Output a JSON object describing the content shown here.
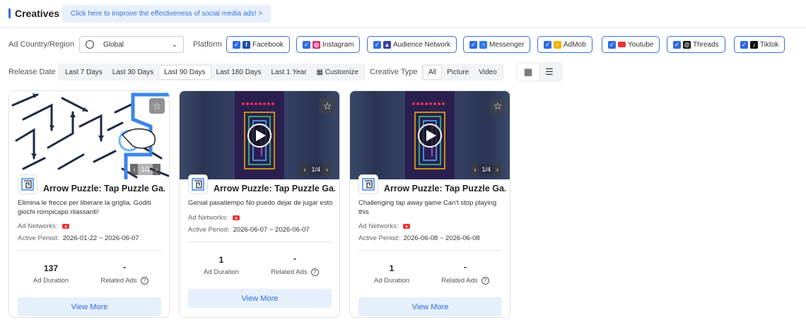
{
  "header": {
    "title": "Creatives",
    "promo": "Click here to improve the effectiveness of social media ads! >"
  },
  "filters": {
    "country_label": "Ad Country/Region",
    "country_value": "Global",
    "platform_label": "Platform",
    "platforms": [
      "Facebook",
      "Instagram",
      "Audience Network",
      "Messenger",
      "AdMob",
      "Youtube",
      "Threads",
      "Tiktok"
    ],
    "release_label": "Release Date",
    "release_options": [
      "Last 7 Days",
      "Last 30 Days",
      "Last 90 Days",
      "Last 180 Days",
      "Last 1 Year",
      "Customize"
    ],
    "release_selected": "Last 90 Days",
    "creative_label": "Creative Type",
    "creative_options": [
      "All",
      "Picture",
      "Video"
    ],
    "creative_selected": "All"
  },
  "cards": [
    {
      "title": "Arrow Puzzle: Tap Puzzle Ga...",
      "description": "Elimina le frecce per liberare la griglia. Goditi giochi rompicapo rilassanti!",
      "networks_label": "Ad Networks:",
      "period_label": "Active Period:",
      "period": "2026-01-22 ~ 2026-06-07",
      "pager": "1/2",
      "duration_value": "137",
      "duration_label": "Ad Duration",
      "related_value": "-",
      "related_label": "Related Ads",
      "button": "View More",
      "type": "picture"
    },
    {
      "title": "Arrow Puzzle: Tap Puzzle Ga...",
      "description": "Genial pasatiempo No puedo dejar de jugar esto",
      "networks_label": "Ad Networks:",
      "period_label": "Active Period:",
      "period": "2026-06-07 ~ 2026-06-07",
      "pager": "1/4",
      "duration_value": "1",
      "duration_label": "Ad Duration",
      "related_value": "-",
      "related_label": "Related Ads",
      "button": "View More",
      "type": "video"
    },
    {
      "title": "Arrow Puzzle: Tap Puzzle Ga...",
      "description": "Challenging tap away game Can't stop playing this",
      "networks_label": "Ad Networks:",
      "period_label": "Active Period:",
      "period": "2026-06-08 ~ 2026-06-08",
      "pager": "1/4",
      "duration_value": "1",
      "duration_label": "Ad Duration",
      "related_value": "-",
      "related_label": "Related Ads",
      "button": "View More",
      "type": "video"
    }
  ],
  "colors": {
    "accent": "#2d6be4",
    "youtube": "#e33333"
  }
}
